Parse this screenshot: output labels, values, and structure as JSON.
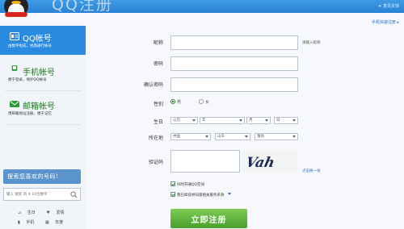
{
  "header": {
    "title": "QQ注册",
    "feedback_label": "意见反馈"
  },
  "sidebar": {
    "items": [
      {
        "title": "QQ帐号",
        "subtitle": "由数字组成，经典通行帐号",
        "icon": "id-card-icon"
      },
      {
        "title": "手机帐号",
        "subtitle": "便于登录，保护QQ帐号",
        "icon": "phone-icon"
      },
      {
        "title": "邮箱帐号",
        "subtitle": "用邮箱地址注册，便于记忆",
        "icon": "mail-icon"
      }
    ],
    "search_title": "搜索您喜欢的号码!",
    "search_placeholder": "输入 搜索 的 4-10位数字",
    "tags": [
      [
        "生日",
        "爱情"
      ],
      [
        "手机",
        "年度"
      ]
    ]
  },
  "main": {
    "top_link": "手机快速注册",
    "form": {
      "nickname_label": "昵称",
      "nickname_hint": "请输入昵称",
      "password_label": "密码",
      "confirm_label": "确认密码",
      "gender_label": "性别",
      "gender_options": [
        "男",
        "女"
      ],
      "gender_selected": "男",
      "birthday_label": "生日",
      "birthday_selects": [
        "公历",
        "年",
        "月",
        "日"
      ],
      "location_label": "所在地",
      "location_selects": [
        "中国",
        "山东",
        "潍坊"
      ],
      "captcha_label": "验证码",
      "captcha_text": "Vah",
      "swap_link": "点击换一张",
      "checkbox_qzone": "同时开通QQ空间",
      "checkbox_terms": "我已阅读并同意相关服务条款",
      "submit_label": "立即注册"
    }
  },
  "colors": {
    "header": "#2a82d6",
    "active_tab": "#2a8ae0",
    "submit": "#4a9e2e",
    "link": "#2c6fc3"
  }
}
